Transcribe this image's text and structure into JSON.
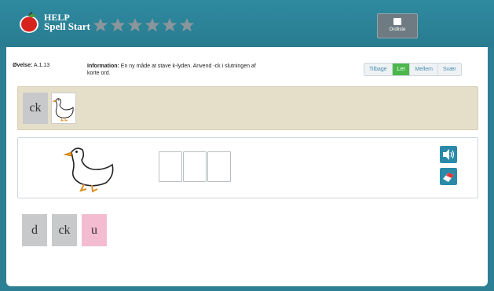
{
  "app": {
    "logo_line1": "HELP",
    "logo_line2": "Spell Start",
    "star_count": 6,
    "ordliste_label": "Ordliste"
  },
  "exercise": {
    "label": "Øvelse:",
    "id": "A.1.13",
    "info_label": "Information:",
    "info_text": "En ny måde at stave k-lyden. Anvend -ck i slutningen af korte ord."
  },
  "levels": [
    {
      "label": "Tilbage",
      "active": false
    },
    {
      "label": "Let",
      "active": true
    },
    {
      "label": "Mellem",
      "active": false
    },
    {
      "label": "Svær",
      "active": false
    }
  ],
  "example": {
    "letters": "ck",
    "image": "duck"
  },
  "workspace": {
    "image": "duck",
    "slots": 3,
    "icons": [
      "speaker-icon",
      "eraser-icon"
    ]
  },
  "tiles": [
    {
      "text": "d",
      "color": "#c8c9cb"
    },
    {
      "text": "ck",
      "color": "#c8c9cb"
    },
    {
      "text": "u",
      "color": "#f4bcd0"
    }
  ],
  "colors": {
    "frame": "#2d7f93",
    "strip": "#e5dfca",
    "active_level": "#4cb84c",
    "pink_tile": "#f4bcd0"
  }
}
